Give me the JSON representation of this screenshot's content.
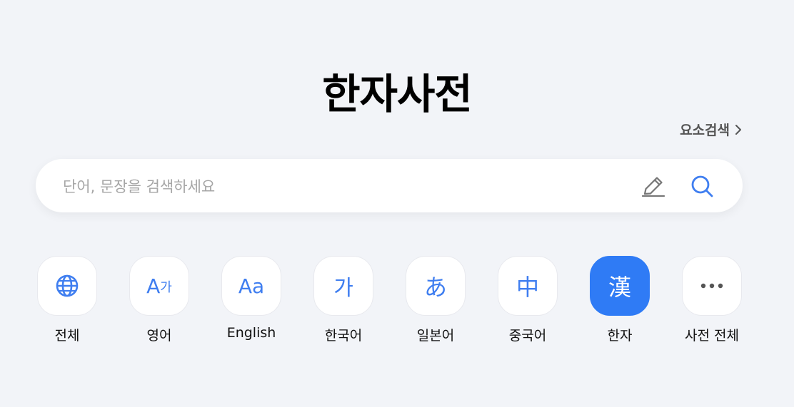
{
  "header": {
    "title": "한자사전",
    "element_search_label": "요소검색"
  },
  "search": {
    "placeholder": "단어, 문장을 검색하세요",
    "value": ""
  },
  "categories": [
    {
      "label": "전체",
      "icon": "globe-icon",
      "active": false
    },
    {
      "label": "영어",
      "icon_text_main": "A",
      "icon_text_sub": "가",
      "active": false
    },
    {
      "label": "English",
      "icon_text": "Aa",
      "active": false
    },
    {
      "label": "한국어",
      "icon_text": "가",
      "active": false
    },
    {
      "label": "일본어",
      "icon_text": "あ",
      "active": false
    },
    {
      "label": "중국어",
      "icon_text": "中",
      "active": false
    },
    {
      "label": "한자",
      "icon_text": "漢",
      "active": true
    },
    {
      "label": "사전 전체",
      "icon": "more-icon",
      "active": false
    }
  ],
  "colors": {
    "accent": "#2f7bf5",
    "icon_blue": "#3f7ef0",
    "background": "#f2f4f8"
  }
}
